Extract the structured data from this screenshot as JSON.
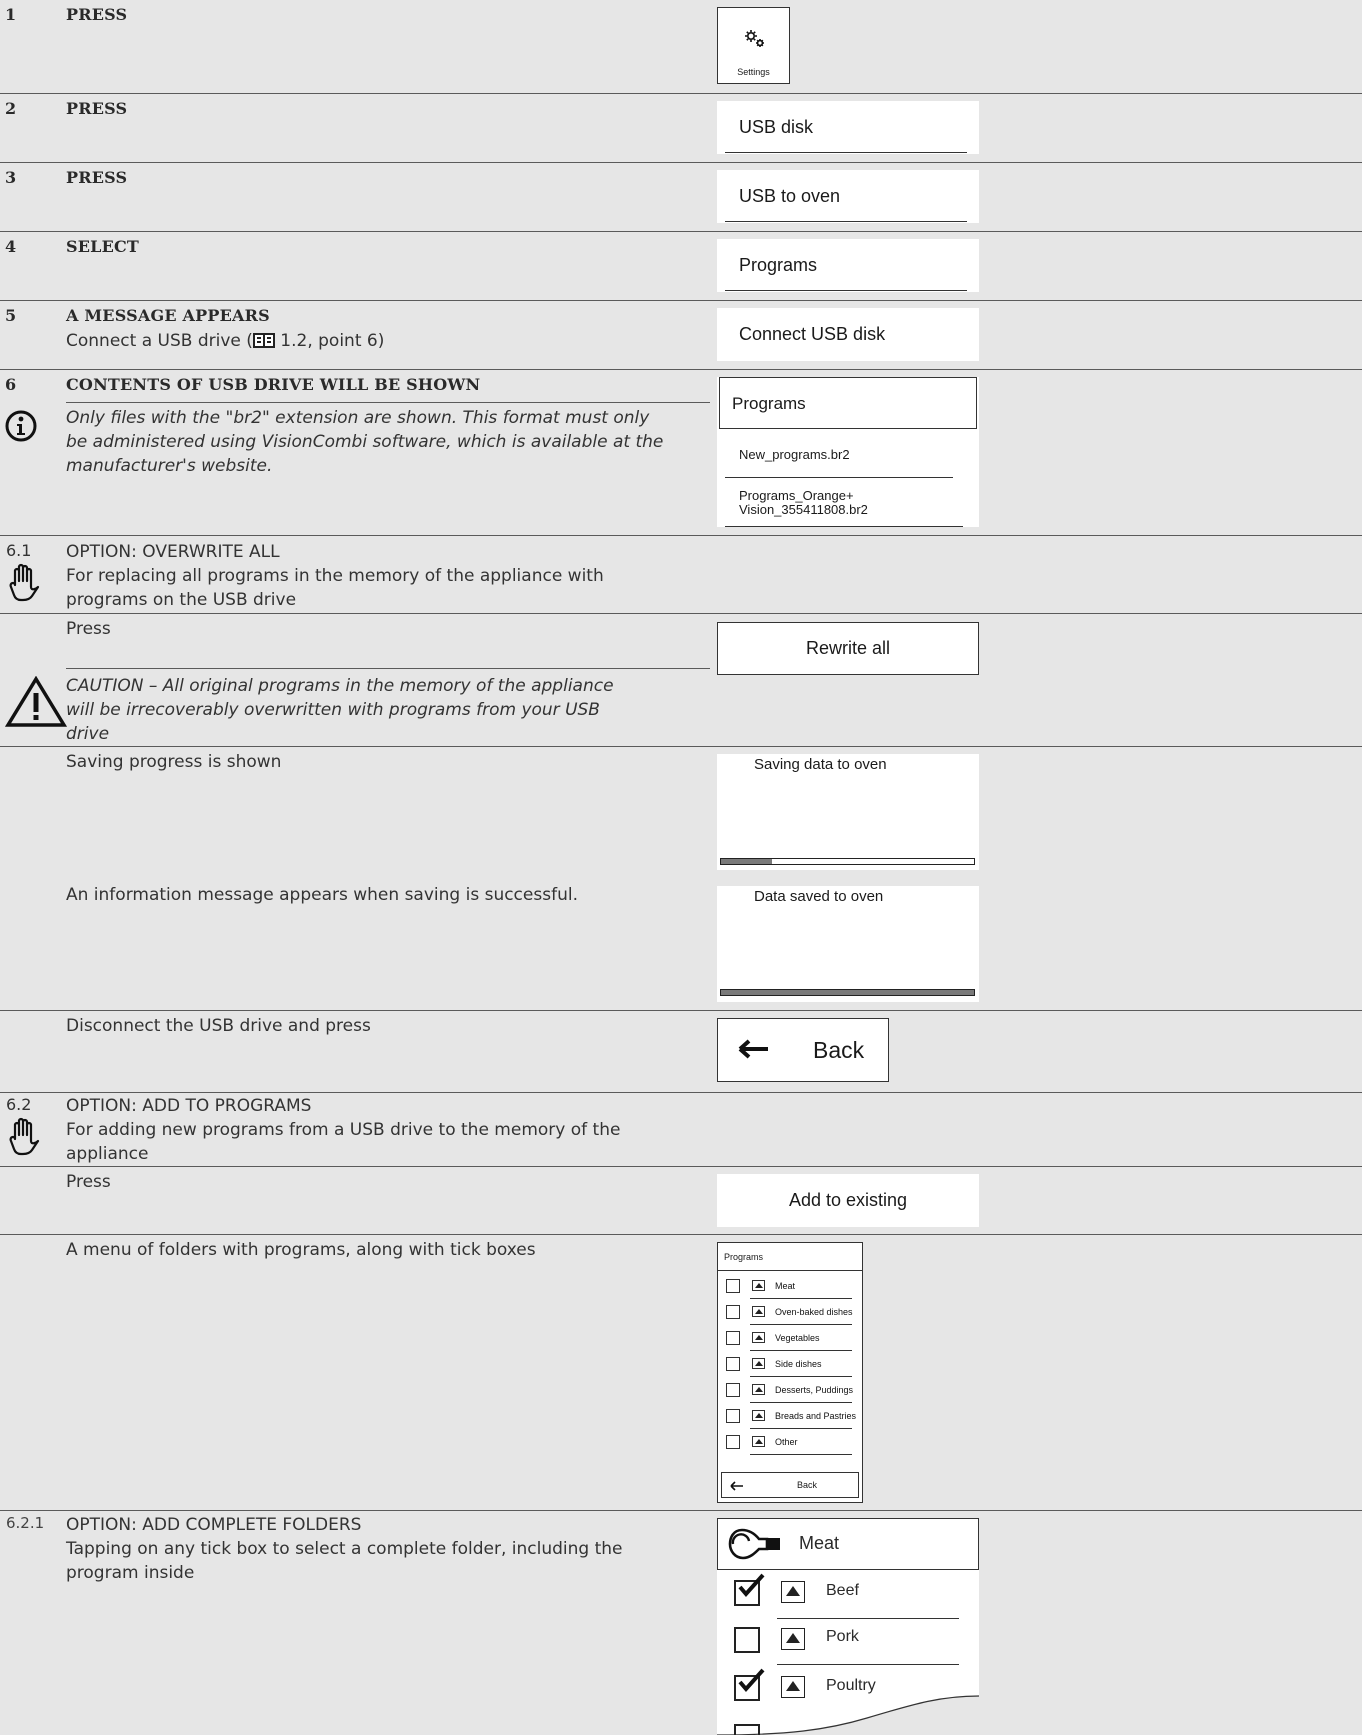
{
  "steps": {
    "s1": {
      "num": "1",
      "head": "PRESS"
    },
    "s2": {
      "num": "2",
      "head": "PRESS"
    },
    "s3": {
      "num": "3",
      "head": "PRESS"
    },
    "s4": {
      "num": "4",
      "head": "SELECT"
    },
    "s5": {
      "num": "5",
      "head": "A MESSAGE APPEARS",
      "text_before": "Connect a USB drive (",
      "text_after": "1.2, point 6)",
      "icon": "book-icon"
    },
    "s6": {
      "num": "6",
      "head": "CONTENTS OF USB DRIVE WILL BE SHOWN",
      "note": "Only files with the \"br2\" extension are shown. This format must only be administered using VisionCombi software, which is available at the manufacturer's website.",
      "note_icon": "info-icon"
    }
  },
  "opt61": {
    "num": "6.1",
    "icon": "hand-icon",
    "title": "OPTION: OVERWRITE ALL",
    "desc": "For replacing all programs in the memory of the appliance with programs on the USB drive",
    "press": "Press",
    "caution_icon": "warning-icon",
    "caution": "CAUTION – All original programs in the memory of the appliance will be irrecoverably overwritten with programs from your USB drive",
    "progress_text": "Saving progress is shown",
    "success_text": "An information message appears when saving is successful.",
    "disconnect_text": "Disconnect the USB drive and press"
  },
  "opt62": {
    "num": "6.2",
    "icon": "hand-icon",
    "title": "OPTION: ADD TO PROGRAMS",
    "desc": "For adding new programs from a USB drive to the memory of the appliance",
    "press": "Press",
    "menu_text": "A menu of folders with programs, along with tick boxes"
  },
  "opt621": {
    "num": "6.2.1",
    "title": "OPTION: ADD COMPLETE FOLDERS",
    "desc": "Tapping on any tick box to select a complete folder, including the program inside"
  },
  "screens": {
    "settings": {
      "label": "Settings",
      "icon": "gears-icon"
    },
    "usb_disk": "USB disk",
    "usb_to_oven": "USB to oven",
    "programs": "Programs",
    "connect_usb": "Connect USB disk",
    "file_list": {
      "title": "Programs",
      "files": [
        "New_programs.br2",
        "Programs_Orange+",
        "Vision_355411808.br2"
      ]
    },
    "rewrite_all": "Rewrite all",
    "saving": {
      "title": "Saving data to oven",
      "progress": 0.2
    },
    "saved": {
      "title": "Data saved to oven",
      "progress": 1.0
    },
    "back": {
      "label": "Back",
      "icon": "arrow-left-icon"
    },
    "add_existing": "Add to existing",
    "folders": {
      "title": "Programs",
      "items": [
        "Meat",
        "Oven-baked dishes",
        "Vegetables",
        "Side dishes",
        "Desserts, Puddings",
        "Breads and Pastries",
        "Other"
      ],
      "back": "Back"
    },
    "meat": {
      "title": "Meat",
      "icon": "meat-icon",
      "items": [
        {
          "label": "Beef",
          "checked": true
        },
        {
          "label": "Pork",
          "checked": false
        },
        {
          "label": "Poultry",
          "checked": true
        }
      ]
    }
  }
}
